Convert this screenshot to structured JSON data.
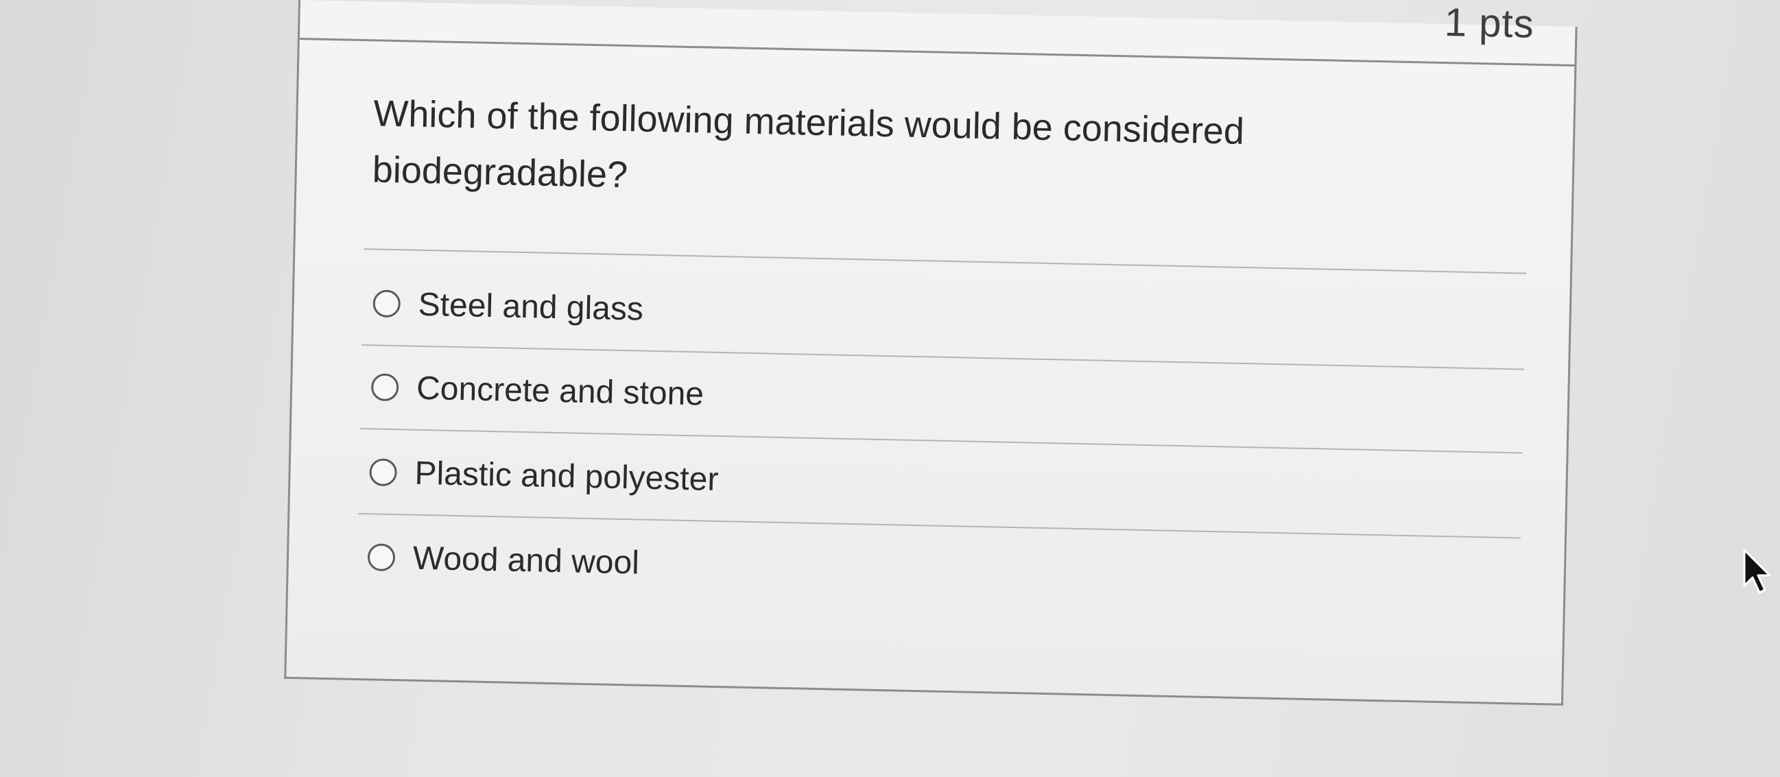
{
  "header": {
    "points_label": "1 pts"
  },
  "question": {
    "text": "Which of the following materials would be considered biodegradable?"
  },
  "answers": [
    {
      "label": "Steel and glass"
    },
    {
      "label": "Concrete and stone"
    },
    {
      "label": "Plastic and polyester"
    },
    {
      "label": "Wood and wool"
    }
  ],
  "colors": {
    "border": "#8c8c8c",
    "text": "#2b2b2b",
    "background": "#e4e4e4"
  },
  "icons": {
    "cursor": "mouse-pointer-icon",
    "radio": "radio-button-icon"
  }
}
